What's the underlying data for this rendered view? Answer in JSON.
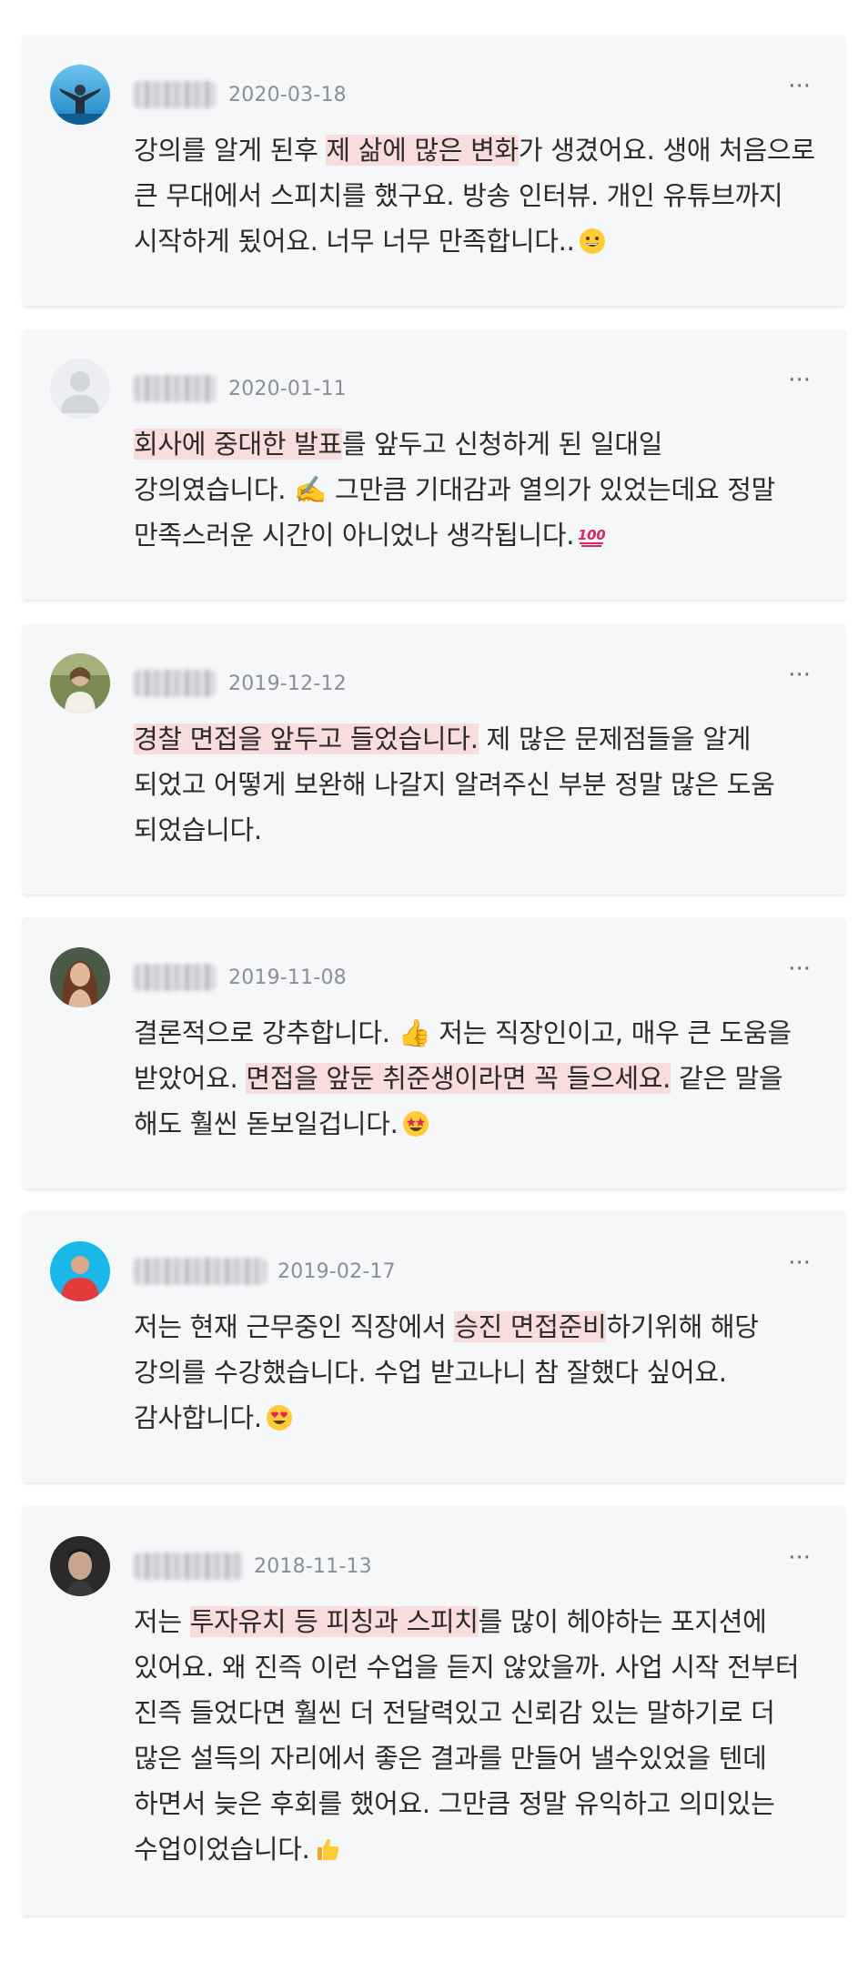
{
  "reviews": [
    {
      "date": "2020-03-18",
      "more_label": "···",
      "avatar_icon": "sky-person-avatar",
      "emoji_icon": "grinning-face-emoji",
      "text": {
        "a": "강의를 알게 된후 ",
        "h": "제 삶에 많은 변화",
        "b": "가 생겼어요. 생애 처음으로 큰 무대에서 스피치를 했구요. 방송 인터뷰. 개인 유튜브까지 시작하게 됬어요. 너무 너무 만족합니다.."
      }
    },
    {
      "date": "2020-01-11",
      "more_label": "···",
      "avatar_icon": "default-user-avatar",
      "emoji_icon": "hundred-points-emoji",
      "text": {
        "a": "",
        "h": "회사에 중대한 발표",
        "b": "를 앞두고 신청하게 된 일대일 강의였습니다. ✍️ 그만큼 기대감과 열의가 있었는데요 정말 만족스러운 시간이 아니었나 생각됩니다."
      }
    },
    {
      "date": "2019-12-12",
      "more_label": "···",
      "avatar_icon": "outdoor-person-avatar",
      "emoji_icon": "",
      "text": {
        "a": "",
        "h": "경찰 면접을 앞두고 들었습니다.",
        "b": " 제 많은 문제점들을 알게 되었고 어떻게 보완해 나갈지 알려주신 부분 정말 많은 도움 되었습니다."
      }
    },
    {
      "date": "2019-11-08",
      "more_label": "···",
      "avatar_icon": "woman-portrait-avatar",
      "emoji_icon": "star-struck-emoji",
      "text": {
        "a": "결론적으로 강추합니다. 👍 저는 직장인이고, 매우 큰 도움을 받았어요. ",
        "h": "면접을 앞둔 취준생이라면 꼭 들으세요.",
        "b": " 같은 말을 해도 훨씬 돋보일겁니다."
      }
    },
    {
      "date": "2019-02-17",
      "more_label": "···",
      "avatar_icon": "cyan-red-avatar",
      "emoji_icon": "heart-eyes-emoji",
      "text": {
        "a": "저는 현재 근무중인 직장에서 ",
        "h": "승진 면접준비",
        "b": "하기위해 해당 강의를 수강했습니다. 수업 받고나니 참 잘했다 싶어요. 감사합니다."
      }
    },
    {
      "date": "2018-11-13",
      "more_label": "···",
      "avatar_icon": "man-portrait-avatar",
      "emoji_icon": "thumbs-up-emoji",
      "text": {
        "a": "저는 ",
        "h": "투자유치 등 피칭과 스피치",
        "b": "를 많이 헤야하는 포지션에 있어요. 왜 진즉 이런 수업을 듣지 않았을까. 사업 시작 전부터 진즉 들었다면 훨씬 더 전달력있고 신뢰감 있는 말하기로 더 많은 설득의 자리에서 좋은 결과를 만들어 낼수있었을 텐데 하면서 늦은 후회를 했어요. 그만큼 정말 유익하고 의미있는 수업이었습니다."
      }
    }
  ],
  "colors": {
    "card_bg": "#f6f7f9",
    "highlight": "#f9dcdc",
    "date": "#8a8f97",
    "text": "#2b2b2b"
  }
}
